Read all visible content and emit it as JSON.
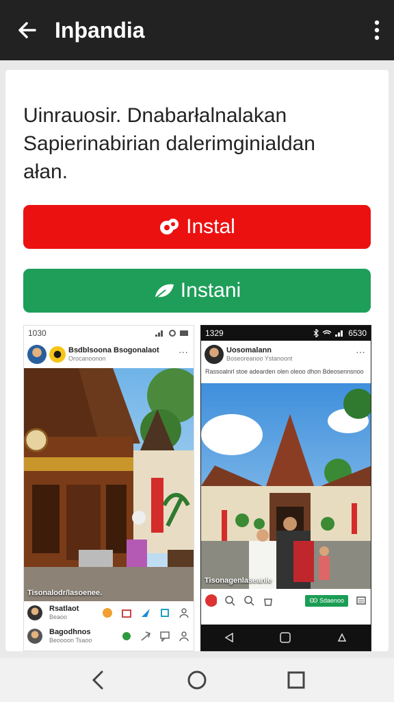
{
  "appbar": {
    "title": "Inþandia",
    "back_icon": "arrow-left-icon",
    "more_icon": "more-vert-icon"
  },
  "content": {
    "description": "Uinrauosir. Dnabarłalnalakan Sapierinabirian dalerimginialdan ałan."
  },
  "buttons": {
    "primary_label": "Instal",
    "secondary_label": "Instani",
    "primary_color": "#ec1111",
    "secondary_color": "#1f9e5a"
  },
  "preview_left": {
    "status_time": "1030",
    "post_name": "Bsdblsoona Bsogonalaot",
    "post_sub": "Orocanoonon",
    "photo_caption": "Tisonalodr/lasoenee.",
    "footer_row1_name": "Rsatlaot",
    "footer_row1_sub": "Beaoo",
    "footer_row2_name": "Bagodhnos",
    "footer_row2_sub": "Beoooon Tsaoo"
  },
  "preview_right": {
    "status_time": "1329",
    "status_battery": "6530",
    "post_name": "Uosomalann",
    "post_sub": "Boseoreanoo Ystanoont",
    "caption": "Rassoalnrl stoe adearden olen oleoo dhon Bdeosennsnoo",
    "photo_caption": "Tisonagenlaseanle",
    "action_button": "Ꙭ Sdaenoo"
  }
}
